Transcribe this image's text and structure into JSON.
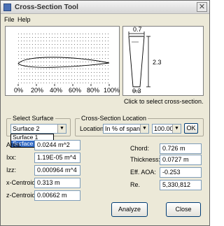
{
  "window": {
    "title": "Cross-Section Tool"
  },
  "menu": {
    "items": [
      "File",
      "Help"
    ]
  },
  "plot": {
    "tick_labels": [
      "0%",
      "20%",
      "40%",
      "60%",
      "80%",
      "100%"
    ]
  },
  "planform": {
    "top_dim": "0.7",
    "side_dim": "2.3",
    "bottom_dim": "0.3",
    "caption": "Click to select cross-section."
  },
  "select_surface": {
    "label": "Select Surface",
    "selected": "Surface 2",
    "options": [
      "Surface 1",
      "Surface 2"
    ]
  },
  "cross_section_location": {
    "label": "Cross-Section Location",
    "location_label": "Location:",
    "location_value": "In % of span",
    "percent_value": "100.00",
    "ok_label": "OK"
  },
  "properties": {
    "area": {
      "label": "Area:",
      "value": "0.0244 m^2"
    },
    "ixx": {
      "label": "Ixx:",
      "value": "1.19E-05 m^4"
    },
    "izz": {
      "label": "Izz:",
      "value": "0.000964 m^4"
    },
    "x_centroid": {
      "label": "x-Centroid:",
      "value": "0.313 m"
    },
    "z_centroid": {
      "label": "z-Centroid:",
      "value": "0.00662 m"
    },
    "chord": {
      "label": "Chord:",
      "value": "0.726 m"
    },
    "thickness": {
      "label": "Thickness:",
      "value": "0.0727 m"
    },
    "eff_aoa": {
      "label": "Eff. AOA:",
      "value": "-0.253"
    },
    "re": {
      "label": "Re.",
      "value": "5,330,812"
    }
  },
  "buttons": {
    "analyze": "Analyze",
    "close": "Close"
  }
}
